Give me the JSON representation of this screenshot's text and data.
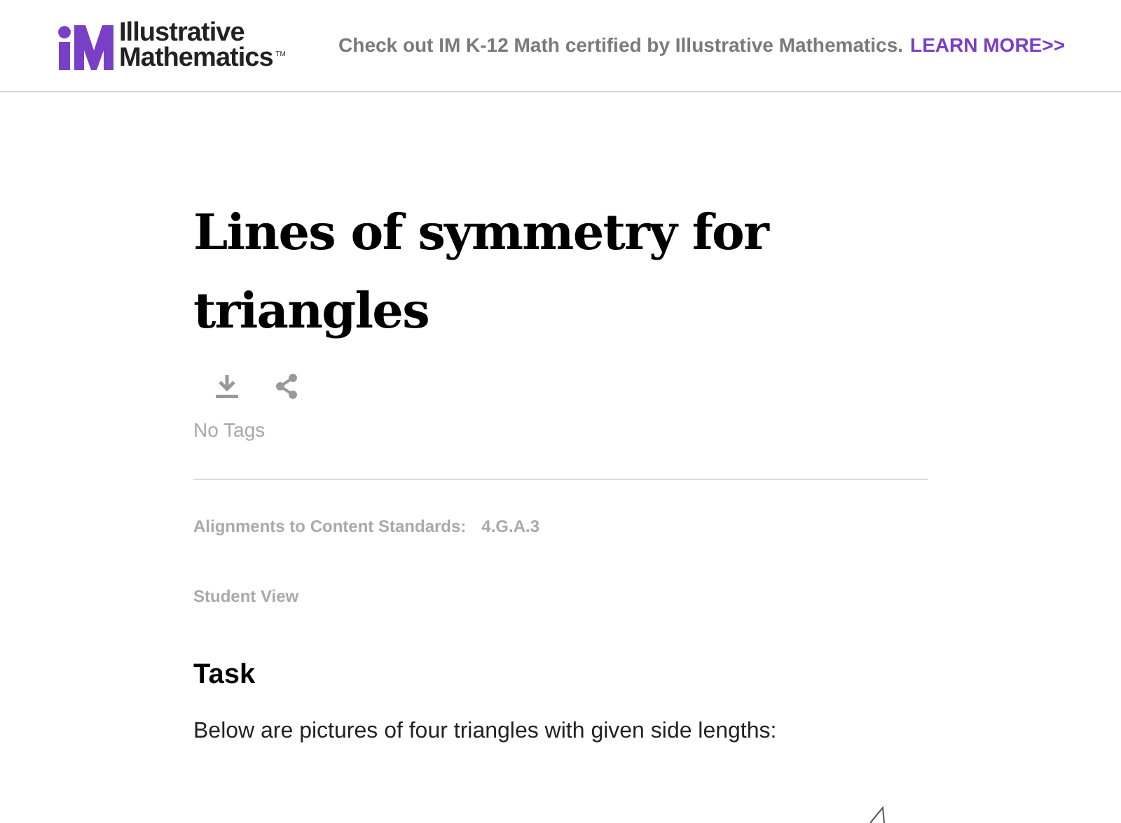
{
  "header": {
    "logo": {
      "line_1": "Illustrative",
      "line_2": "Mathematics",
      "trademark": "TM"
    },
    "promo": {
      "text": "Check out IM K-12 Math certified by Illustrative Mathematics.",
      "link": "LEARN MORE>>"
    }
  },
  "task_page": {
    "title": "Lines of symmetry for triangles",
    "tags": "No Tags",
    "alignments": {
      "label": "Alignments to Content Standards:",
      "standard": "4.G.A.3"
    },
    "view": "Student View",
    "section_heading": "Task",
    "body": "Below are pictures of four triangles with given side lengths:"
  }
}
